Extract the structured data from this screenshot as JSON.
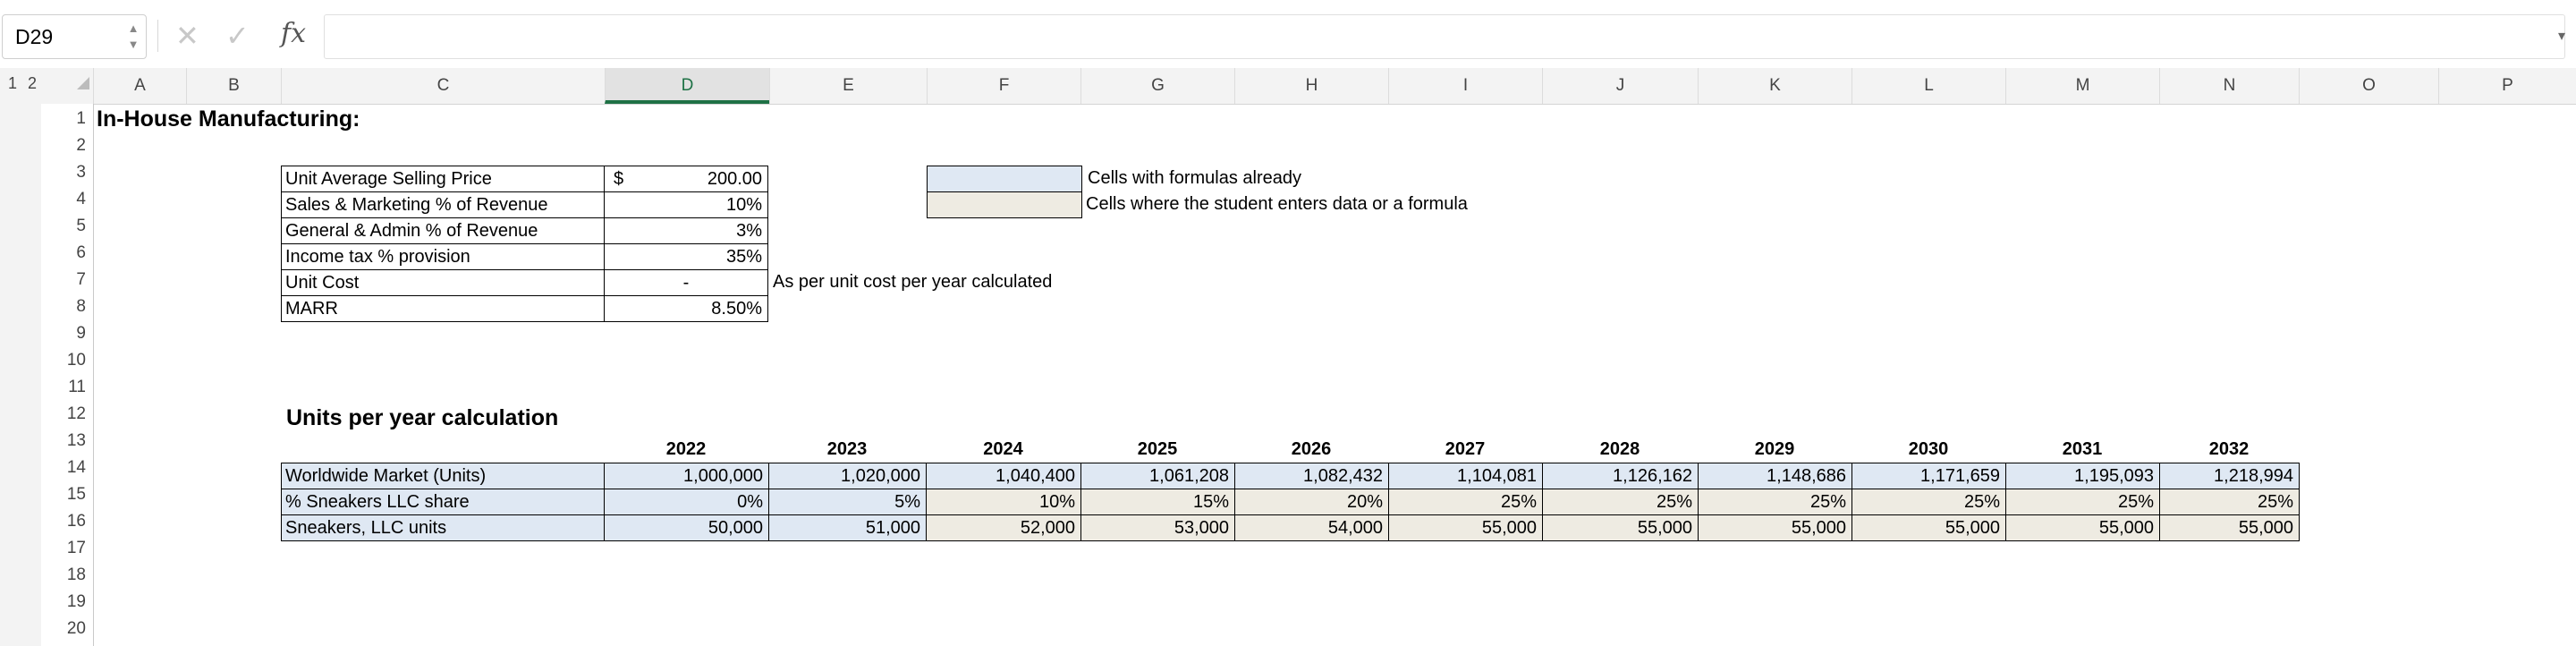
{
  "formula_bar": {
    "name_box": "D29",
    "cancel_glyph": "✕",
    "enter_glyph": "✓",
    "fx_label": "fx",
    "formula": "",
    "dropdown_glyph": "▾"
  },
  "outline_levels": [
    "1",
    "2"
  ],
  "columns": [
    "A",
    "B",
    "C",
    "D",
    "E",
    "F",
    "G",
    "H",
    "I",
    "J",
    "K",
    "L",
    "M",
    "N",
    "O",
    "P"
  ],
  "selected_column": "D",
  "rows": [
    "1",
    "2",
    "3",
    "4",
    "5",
    "6",
    "7",
    "8",
    "9",
    "10",
    "11",
    "12",
    "13",
    "14",
    "15",
    "16",
    "17",
    "18",
    "19",
    "20"
  ],
  "sheet": {
    "title": "In-House Manufacturing:",
    "params": [
      {
        "label": "Unit Average Selling Price",
        "currency": "$",
        "value": "200.00"
      },
      {
        "label": "Sales & Marketing % of Revenue",
        "currency": "",
        "value": "10%"
      },
      {
        "label": "General & Admin % of Revenue",
        "currency": "",
        "value": "3%"
      },
      {
        "label": "Income tax % provision",
        "currency": "",
        "value": "35%"
      },
      {
        "label": "Unit Cost",
        "currency": "",
        "value": "-"
      },
      {
        "label": "MARR",
        "currency": "",
        "value": "8.50%"
      }
    ],
    "unit_cost_note": "As per unit cost per year calculated",
    "legend": [
      {
        "label": "Cells with formulas already",
        "color": "#dfe8f3"
      },
      {
        "label": "Cells where the student enters data or a formula",
        "color": "#eeebe2"
      }
    ],
    "units_section_title": "Units per year calculation",
    "years": [
      "2022",
      "2023",
      "2024",
      "2025",
      "2026",
      "2027",
      "2028",
      "2029",
      "2030",
      "2031",
      "2032"
    ],
    "unit_rows": [
      {
        "label": "Worldwide Market (Units)",
        "values": [
          "1,000,000",
          "1,020,000",
          "1,040,400",
          "1,061,208",
          "1,082,432",
          "1,104,081",
          "1,126,162",
          "1,148,686",
          "1,171,659",
          "1,195,093",
          "1,218,994"
        ]
      },
      {
        "label": "% Sneakers LLC share",
        "values": [
          "0%",
          "5%",
          "10%",
          "15%",
          "20%",
          "25%",
          "25%",
          "25%",
          "25%",
          "25%",
          "25%"
        ]
      },
      {
        "label": "Sneakers, LLC units",
        "values": [
          "50,000",
          "51,000",
          "52,000",
          "53,000",
          "54,000",
          "55,000",
          "55,000",
          "55,000",
          "55,000",
          "55,000",
          "55,000"
        ]
      }
    ]
  }
}
